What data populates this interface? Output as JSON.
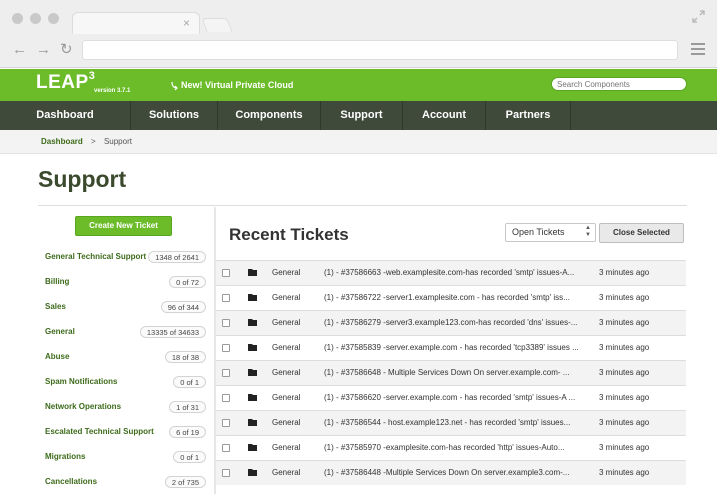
{
  "browser": {
    "tab_close": "×",
    "back_icon": "←",
    "forward_icon": "→",
    "reload_icon": "↻"
  },
  "header": {
    "logo": "LEAP",
    "logo_sup": "3",
    "version": "version 3.7.1",
    "promo": "New! Virtual Private Cloud",
    "search_placeholder": "Search Components",
    "brand_color": "#6cbc29",
    "nav_color": "#3f4a3b"
  },
  "nav": {
    "items": [
      {
        "label": "Dashboard"
      },
      {
        "label": "Solutions"
      },
      {
        "label": "Components"
      },
      {
        "label": "Support"
      },
      {
        "label": "Account"
      },
      {
        "label": "Partners"
      }
    ]
  },
  "breadcrumb": {
    "link": "Dashboard",
    "sep": ">",
    "current": "Support"
  },
  "page": {
    "title": "Support"
  },
  "sidebar": {
    "create_label": "Create New Ticket",
    "categories": [
      {
        "label": "General Technical Support",
        "count": "1348 of 2641"
      },
      {
        "label": "Billing",
        "count": "0 of 72"
      },
      {
        "label": "Sales",
        "count": "96 of 344"
      },
      {
        "label": "General",
        "count": "13335 of 34633"
      },
      {
        "label": "Abuse",
        "count": "18 of 38"
      },
      {
        "label": "Spam Notifications",
        "count": "0 of 1"
      },
      {
        "label": "Network Operations",
        "count": "1 of 31"
      },
      {
        "label": "Escalated Technical Support",
        "count": "6 of 19"
      },
      {
        "label": "Migrations",
        "count": "0 of 1"
      },
      {
        "label": "Cancellations",
        "count": "2 of 735"
      }
    ]
  },
  "tickets": {
    "title": "Recent Tickets",
    "filter_value": "Open Tickets",
    "close_label": "Close Selected",
    "rows": [
      {
        "dept": "General",
        "subject": "(1) - #37586663 -web.examplesite.com-has recorded 'smtp' issues-A...",
        "time": "3 minutes ago"
      },
      {
        "dept": "General",
        "subject": "(1) - #37586722 -server1.examplesite.com - has recorded 'smtp' iss...",
        "time": "3 minutes ago"
      },
      {
        "dept": "General",
        "subject": "(1) - #37586279 -server3.example123.com-has recorded 'dns' issues-...",
        "time": "3 minutes ago"
      },
      {
        "dept": "General",
        "subject": "(1) - #37585839 -server.example.com - has recorded 'tcp3389' issues ...",
        "time": "3 minutes ago"
      },
      {
        "dept": "General",
        "subject": "(1) - #37586648 - Multiple Services Down On server.example.com- ...",
        "time": "3 minutes ago"
      },
      {
        "dept": "General",
        "subject": "(1) - #37586620 -server.example.com - has recorded 'smtp' issues-A ...",
        "time": "3 minutes ago"
      },
      {
        "dept": "General",
        "subject": "(1) - #37586544 - host.example123.net - has recorded 'smtp' issues...",
        "time": "3 minutes ago"
      },
      {
        "dept": "General",
        "subject": "(1) - #37585970 -examplesite.com-has recorded 'http' issues-Auto...",
        "time": "3 minutes ago"
      },
      {
        "dept": "General",
        "subject": "(1) - #37586448 -Multiple Services Down On server.example3.com-...",
        "time": "3 minutes ago"
      }
    ]
  }
}
